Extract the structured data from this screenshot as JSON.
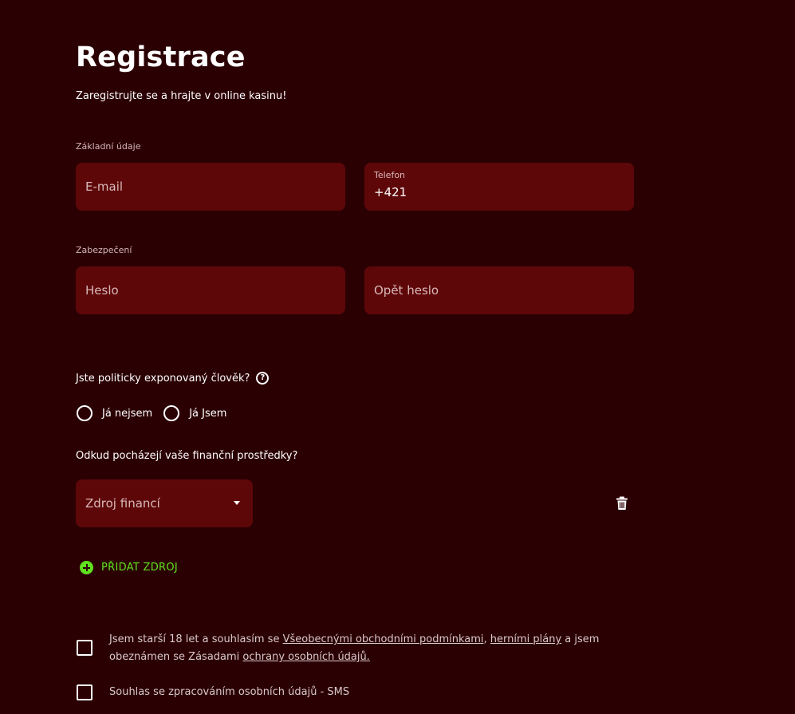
{
  "header": {
    "title": "Registrace",
    "subtitle": "Zaregistrujte se a hrajte v online kasinu!"
  },
  "basic": {
    "section_label": "Základní údaje",
    "email_placeholder": "E-mail",
    "phone_label": "Telefon",
    "phone_value": "+421"
  },
  "security": {
    "section_label": "Zabezpečení",
    "password_placeholder": "Heslo",
    "password_repeat_placeholder": "Opět heslo"
  },
  "pep": {
    "question": "Jste politicky exponovaný člověk?",
    "help_icon": "?",
    "options": [
      {
        "label": "Já nejsem",
        "selected": false
      },
      {
        "label": "Já Jsem",
        "selected": false
      }
    ]
  },
  "funds": {
    "question": "Odkud pocházejí vaše finanční prostředky?",
    "select_label": "Zdroj financí",
    "add_label": "PŘIDAT ZDROJ",
    "delete_icon": "trash-icon"
  },
  "consents": {
    "terms": {
      "text_1": "Jsem starší 18 let a souhlasím se ",
      "link_1": "Všeobecnými obchodními podmínkami",
      "text_2": ", ",
      "link_2": "herními plány",
      "text_3": " a jsem obeznámen se Zásadami ",
      "link_3": "ochrany osobních údajů.",
      "checked": false
    },
    "sms": {
      "text": "Souhlas se zpracováním osobních údajů - SMS",
      "checked": false
    }
  },
  "colors": {
    "background": "#2b0003",
    "field": "#5e0709",
    "accent_green": "#5fe11f",
    "text": "#ffffff"
  }
}
